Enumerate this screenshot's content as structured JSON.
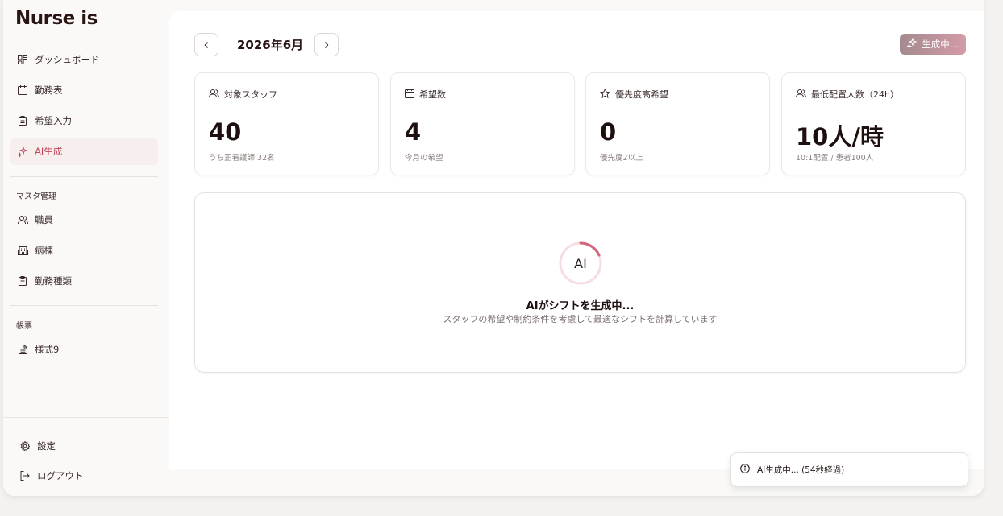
{
  "app": {
    "logo": "Nurse is"
  },
  "sidebar": {
    "items": [
      {
        "label": "ダッシュボード",
        "icon": "dashboard-icon"
      },
      {
        "label": "勤務表",
        "icon": "calendar-icon"
      },
      {
        "label": "希望入力",
        "icon": "clipboard-icon"
      },
      {
        "label": "AI生成",
        "icon": "sparkles-icon",
        "active": true
      }
    ],
    "master_section": "マスタ管理",
    "master_items": [
      {
        "label": "職員",
        "icon": "users-icon"
      },
      {
        "label": "病棟",
        "icon": "building-icon"
      },
      {
        "label": "勤務種類",
        "icon": "clipboard-icon"
      }
    ],
    "forms_section": "帳票",
    "forms_items": [
      {
        "label": "様式9",
        "icon": "document-icon"
      }
    ],
    "settings_label": "設定",
    "logout_label": "ログアウト"
  },
  "header": {
    "month": "2026年6月",
    "prev_label": "‹",
    "next_label": "›",
    "generate_button": "生成中..."
  },
  "stats": [
    {
      "title": "対象スタッフ",
      "value": "40",
      "sub": "うち正看護師 32名",
      "icon": "users-icon"
    },
    {
      "title": "希望数",
      "value": "4",
      "sub": "今月の希望",
      "icon": "calendar-icon"
    },
    {
      "title": "優先度高希望",
      "value": "0",
      "sub": "優先度2以上",
      "icon": "star-icon"
    },
    {
      "title": "最低配置人数（24h）",
      "value": "10人/時",
      "sub": "10:1配置 / 患者100人",
      "icon": "users-icon"
    }
  ],
  "generation": {
    "spinner_label": "AI",
    "title": "AIがシフトを生成中...",
    "subtitle": "スタッフの希望や制約条件を考慮して最適なシフトを計算しています"
  },
  "toast": {
    "message": "AI生成中... (54秒経過)",
    "icon": "info-icon"
  },
  "colors": {
    "accent": "#c0465c",
    "active_bg": "#f7eeee"
  }
}
